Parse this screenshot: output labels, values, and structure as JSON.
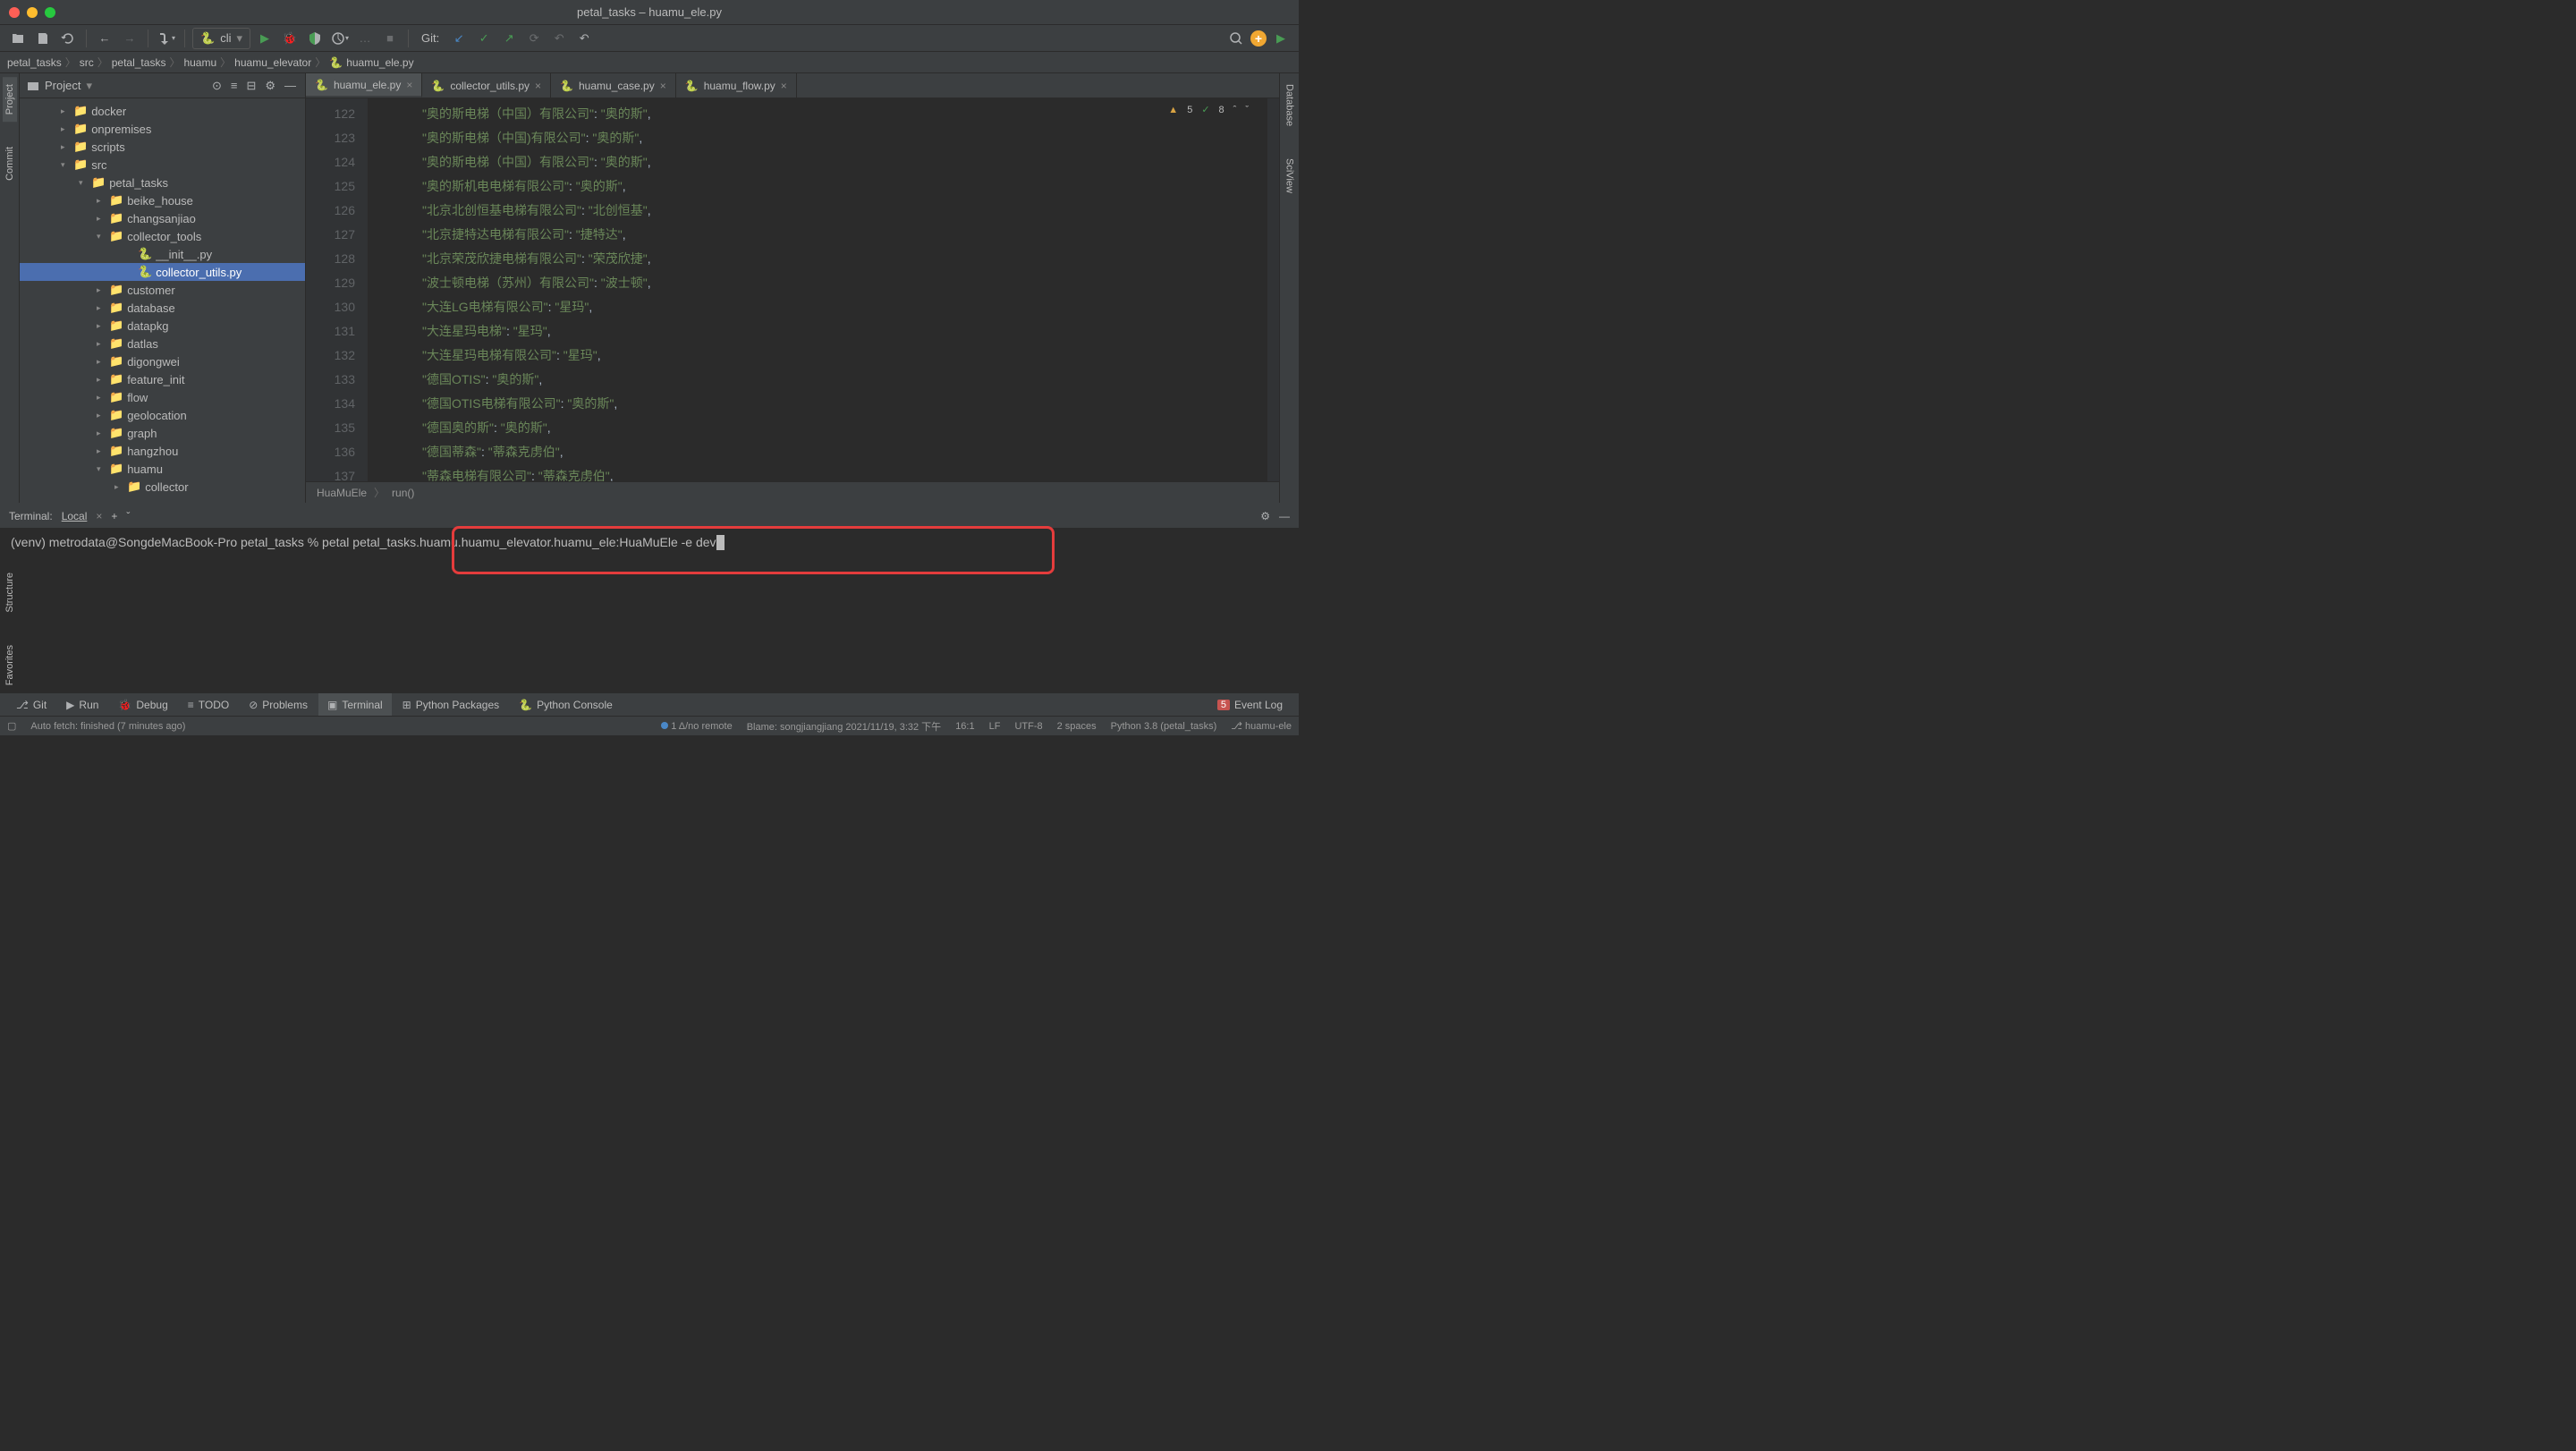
{
  "title": "petal_tasks – huamu_ele.py",
  "run_config": "cli",
  "vcs_label": "Git:",
  "breadcrumbs": [
    "petal_tasks",
    "src",
    "petal_tasks",
    "huamu",
    "huamu_elevator",
    "huamu_ele.py"
  ],
  "project_panel_title": "Project",
  "tree": [
    {
      "label": "docker",
      "indent": 46,
      "arrow": "▸",
      "icon": "folder"
    },
    {
      "label": "onpremises",
      "indent": 46,
      "arrow": "▸",
      "icon": "folder"
    },
    {
      "label": "scripts",
      "indent": 46,
      "arrow": "▸",
      "icon": "folder"
    },
    {
      "label": "src",
      "indent": 46,
      "arrow": "▾",
      "icon": "src"
    },
    {
      "label": "petal_tasks",
      "indent": 66,
      "arrow": "▾",
      "icon": "folder"
    },
    {
      "label": "beike_house",
      "indent": 86,
      "arrow": "▸",
      "icon": "folder"
    },
    {
      "label": "changsanjiao",
      "indent": 86,
      "arrow": "▸",
      "icon": "folder"
    },
    {
      "label": "collector_tools",
      "indent": 86,
      "arrow": "▾",
      "icon": "folder"
    },
    {
      "label": "__init__.py",
      "indent": 118,
      "arrow": "",
      "icon": "py"
    },
    {
      "label": "collector_utils.py",
      "indent": 118,
      "arrow": "",
      "icon": "py",
      "selected": true
    },
    {
      "label": "customer",
      "indent": 86,
      "arrow": "▸",
      "icon": "folder"
    },
    {
      "label": "database",
      "indent": 86,
      "arrow": "▸",
      "icon": "folder"
    },
    {
      "label": "datapkg",
      "indent": 86,
      "arrow": "▸",
      "icon": "folder"
    },
    {
      "label": "datlas",
      "indent": 86,
      "arrow": "▸",
      "icon": "folder"
    },
    {
      "label": "digongwei",
      "indent": 86,
      "arrow": "▸",
      "icon": "folder"
    },
    {
      "label": "feature_init",
      "indent": 86,
      "arrow": "▸",
      "icon": "folder"
    },
    {
      "label": "flow",
      "indent": 86,
      "arrow": "▸",
      "icon": "folder"
    },
    {
      "label": "geolocation",
      "indent": 86,
      "arrow": "▸",
      "icon": "folder"
    },
    {
      "label": "graph",
      "indent": 86,
      "arrow": "▸",
      "icon": "folder"
    },
    {
      "label": "hangzhou",
      "indent": 86,
      "arrow": "▸",
      "icon": "folder"
    },
    {
      "label": "huamu",
      "indent": 86,
      "arrow": "▾",
      "icon": "folder"
    },
    {
      "label": "collector",
      "indent": 106,
      "arrow": "▸",
      "icon": "folder"
    }
  ],
  "editor_tabs": [
    {
      "label": "huamu_ele.py",
      "active": true
    },
    {
      "label": "collector_utils.py",
      "active": false
    },
    {
      "label": "huamu_case.py",
      "active": false
    },
    {
      "label": "huamu_flow.py",
      "active": false
    }
  ],
  "editor_warn_count": "5",
  "editor_ok_count": "8",
  "code_lines": [
    {
      "n": "122",
      "text": "\"奥的斯电梯（中国）有限公司\": \"奥的斯\","
    },
    {
      "n": "123",
      "text": "\"奥的斯电梯（中国)有限公司\": \"奥的斯\","
    },
    {
      "n": "124",
      "text": "\"奥的斯电梯（中国）有限公司\": \"奥的斯\","
    },
    {
      "n": "125",
      "text": "\"奥的斯机电电梯有限公司\": \"奥的斯\","
    },
    {
      "n": "126",
      "text": "\"北京北创恒基电梯有限公司\": \"北创恒基\","
    },
    {
      "n": "127",
      "text": "\"北京捷特达电梯有限公司\": \"捷特达\","
    },
    {
      "n": "128",
      "text": "\"北京荣茂欣捷电梯有限公司\": \"荣茂欣捷\","
    },
    {
      "n": "129",
      "text": "\"波士顿电梯（苏州）有限公司\": \"波士顿\","
    },
    {
      "n": "130",
      "text": "\"大连LG电梯有限公司\": \"星玛\","
    },
    {
      "n": "131",
      "text": "\"大连星玛电梯\": \"星玛\","
    },
    {
      "n": "132",
      "text": "\"大连星玛电梯有限公司\": \"星玛\","
    },
    {
      "n": "133",
      "text": "\"德国OTIS\": \"奥的斯\","
    },
    {
      "n": "134",
      "text": "\"德国OTIS电梯有限公司\": \"奥的斯\","
    },
    {
      "n": "135",
      "text": "\"德国奥的斯\": \"奥的斯\","
    },
    {
      "n": "136",
      "text": "\"德国蒂森\": \"蒂森克虏伯\","
    },
    {
      "n": "137",
      "text": "\"蒂森电梯有限公司\": \"蒂森克虏伯\","
    }
  ],
  "editor_crumb": [
    "HuaMuEle",
    "run()"
  ],
  "terminal": {
    "title": "Terminal:",
    "tab": "Local",
    "prompt": "(venv) metrodata@SongdeMacBook-Pro petal_tasks % ",
    "command": "petal petal_tasks.huamu.huamu_elevator.huamu_ele:HuaMuEle -e dev"
  },
  "bottom_bar": [
    {
      "label": "Git",
      "icon": "⎇"
    },
    {
      "label": "Run",
      "icon": "▶"
    },
    {
      "label": "Debug",
      "icon": "🐞"
    },
    {
      "label": "TODO",
      "icon": "≡"
    },
    {
      "label": "Problems",
      "icon": "⊘"
    },
    {
      "label": "Terminal",
      "icon": "▣",
      "active": true
    },
    {
      "label": "Python Packages",
      "icon": "⊞"
    },
    {
      "label": "Python Console",
      "icon": "🐍"
    }
  ],
  "event_log_badge": "5",
  "event_log_label": "Event Log",
  "status": {
    "auto_fetch": "Auto fetch: finished (7 minutes ago)",
    "remote": "1 Δ/no remote",
    "blame": "Blame: songjiangjiang 2021/11/19, 3:32 下午",
    "pos": "16:1",
    "lf": "LF",
    "enc": "UTF-8",
    "spaces": "2 spaces",
    "interpreter": "Python 3.8 (petal_tasks)",
    "branch": "huamu-ele"
  },
  "right_gutter_tabs": [
    "Database",
    "SciView"
  ],
  "left_gutter_tabs": [
    "Project",
    "Commit"
  ],
  "left_gutter2_tabs": [
    "Structure",
    "Favorites"
  ]
}
